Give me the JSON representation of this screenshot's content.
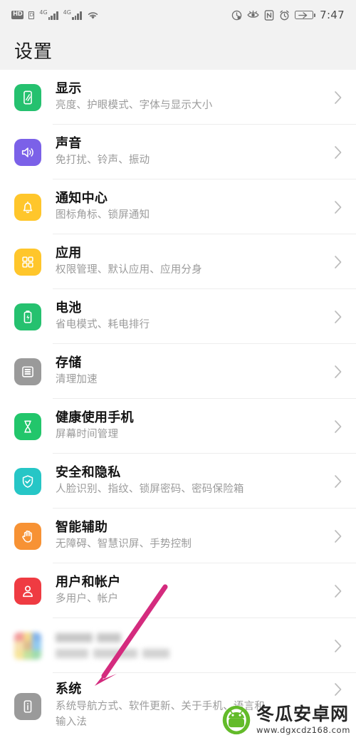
{
  "statusbar": {
    "hd_badge": "HD",
    "sim_label": "D",
    "network_1": "4G",
    "network_2": "4G",
    "wifi": "wifi-icon",
    "right_icons": [
      "data-saver-icon",
      "eye-comfort-icon",
      "nfc-icon",
      "alarm-icon"
    ],
    "battery_label": "battery-charging-icon",
    "time": "7:47"
  },
  "header": {
    "title": "设置"
  },
  "colors": {
    "display": "#25C16F",
    "sound": "#7B61E8",
    "notification": "#FFC62B",
    "apps": "#FFC62B",
    "battery": "#25C16F",
    "storage": "#9A9A9A",
    "health": "#22C66B",
    "security": "#26C6C6",
    "accessibility": "#F79234",
    "users": "#EF3B42",
    "system": "#9A9A9A",
    "annotation_arrow": "#D42B7E",
    "page_background": "#FFFFFF",
    "status_background": "#F2F2F2"
  },
  "list": [
    {
      "icon": "display-icon",
      "title": "显示",
      "subtitle": "亮度、护眼模式、字体与显示大小",
      "blurred": false
    },
    {
      "icon": "sound-icon",
      "title": "声音",
      "subtitle": "免打扰、铃声、振动",
      "blurred": false
    },
    {
      "icon": "notification-bell-icon",
      "title": "通知中心",
      "subtitle": "图标角标、锁屏通知",
      "blurred": false
    },
    {
      "icon": "apps-grid-icon",
      "title": "应用",
      "subtitle": "权限管理、默认应用、应用分身",
      "blurred": false
    },
    {
      "icon": "battery-icon",
      "title": "电池",
      "subtitle": "省电模式、耗电排行",
      "blurred": false
    },
    {
      "icon": "storage-icon",
      "title": "存储",
      "subtitle": "清理加速",
      "blurred": false
    },
    {
      "icon": "hourglass-icon",
      "title": "健康使用手机",
      "subtitle": "屏幕时间管理",
      "blurred": false
    },
    {
      "icon": "shield-check-icon",
      "title": "安全和隐私",
      "subtitle": "人脸识别、指纹、锁屏密码、密码保险箱",
      "blurred": false
    },
    {
      "icon": "hand-icon",
      "title": "智能辅助",
      "subtitle": "无障碍、智慧识屏、手势控制",
      "blurred": false
    },
    {
      "icon": "user-icon",
      "title": "用户和帐户",
      "subtitle": "多用户、帐户",
      "blurred": false
    },
    {
      "icon": "mosaic-icon",
      "title": "",
      "subtitle": "",
      "blurred": true
    },
    {
      "icon": "system-phone-icon",
      "title": "系统",
      "subtitle": "系统导航方式、软件更新、关于手机、语言和",
      "subtitle2": "输入法",
      "blurred": false
    }
  ],
  "annotation": {
    "type": "arrow",
    "points_to": "系统",
    "color": "#D42B7E"
  },
  "watermark": {
    "name": "冬瓜安卓网",
    "url": "www.dgxcdz168.com",
    "logo": "android-robot-icon"
  }
}
